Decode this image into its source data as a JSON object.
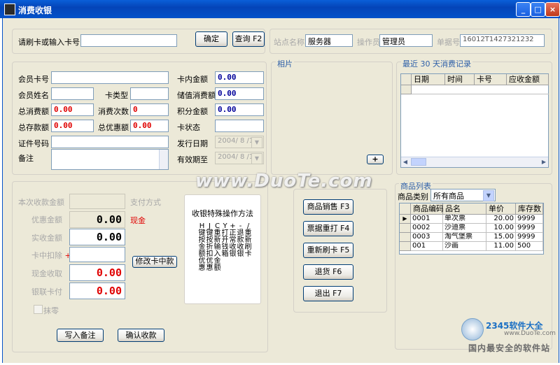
{
  "window": {
    "title": "消费收银",
    "min": "_",
    "max": "□",
    "close": "×"
  },
  "card_entry": {
    "label": "请刷卡或输入卡号",
    "value": "",
    "confirm": "确定",
    "query": "查询 F2"
  },
  "store": {
    "site_label": "站点名称",
    "site_value": "服务器",
    "operator_label": "操作员",
    "operator_value": "管理员",
    "bill_label": "单据号",
    "bill_value": "16012T1427321232"
  },
  "member": {
    "card_no_label": "会员卡号",
    "name_label": "会员姓名",
    "card_type_label": "卡类型",
    "total_consume_label": "总消费额",
    "total_consume": "0.00",
    "consume_count_label": "消费次数",
    "consume_count": "0",
    "total_deposit_label": "总存款额",
    "total_deposit": "0.00",
    "total_discount_label": "总优惠额",
    "total_discount": "0.00",
    "id_label": "证件号码",
    "remark_label": "备注",
    "balance_label": "卡内金额",
    "balance": "0.00",
    "stored_consume_label": "储值消费额",
    "stored_consume": "0.00",
    "points_label": "积分金额",
    "points": "0.00",
    "status_label": "卡状态",
    "issue_date_label": "发行日期",
    "issue_date": "2004/ 8 /19",
    "expire_label": "有效期至",
    "expire_date": "2004/ 8 /19"
  },
  "photo": {
    "label": "相片",
    "add": "+"
  },
  "recent": {
    "label_prefix": "最近",
    "days": "30",
    "label_suffix": "天消费记录",
    "columns": [
      "日期",
      "时间",
      "卡号",
      "应收金额"
    ]
  },
  "payment": {
    "amount_label": "本次收款金额",
    "method_label": "支付方式",
    "discount_label": "优惠金额",
    "discount_value": "0.00",
    "cash_label": "现金",
    "received_label": "实收金额",
    "received_value": "0.00",
    "card_deduct_label": "卡中扣除",
    "card_deduct_mark": "+",
    "cash_in_label": "现金收取",
    "cash_in_value": "0.00",
    "unionpay_label": "银联卡付",
    "unionpay_value": "0.00",
    "modify_button": "修改卡中款",
    "round_label": "抹零",
    "write_remark": "写入备注",
    "confirm_button": "确认收款"
  },
  "help": {
    "title": "收银特殊操作方法",
    "lines": [
      "H 键按金额优惠",
      "J 键按折扣优惠",
      "C 重新输入金额",
      "Y 打开钱箱",
      "+ 正常收银",
      "- 退款收银",
      "/ 重新刷卡"
    ]
  },
  "actions": {
    "sell": "商品销售 F3",
    "reprint": "票据重打 F4",
    "reswipe": "重新刷卡 F5",
    "refund": "退货 F6",
    "exit": "退出 F7"
  },
  "products": {
    "label": "商品列表",
    "category_label": "商品类别",
    "category_value": "所有商品",
    "columns": [
      "商品编码",
      "品名",
      "单价",
      "库存数"
    ],
    "rows": [
      {
        "code": "0001",
        "name": "单次票",
        "price": "20.00",
        "stock": "9999"
      },
      {
        "code": "0002",
        "name": "沙迪票",
        "price": "10.00",
        "stock": "9999"
      },
      {
        "code": "0003",
        "name": "淘气堡票",
        "price": "15.00",
        "stock": "9999"
      },
      {
        "code": "001",
        "name": "沙画",
        "price": "11.00",
        "stock": "500"
      }
    ]
  },
  "watermark": {
    "site": "www.DuoTe.com",
    "brand": "2345软件大全",
    "slogan": "国内最安全的软件站",
    "brand_url": "www.DuoTe.com"
  }
}
